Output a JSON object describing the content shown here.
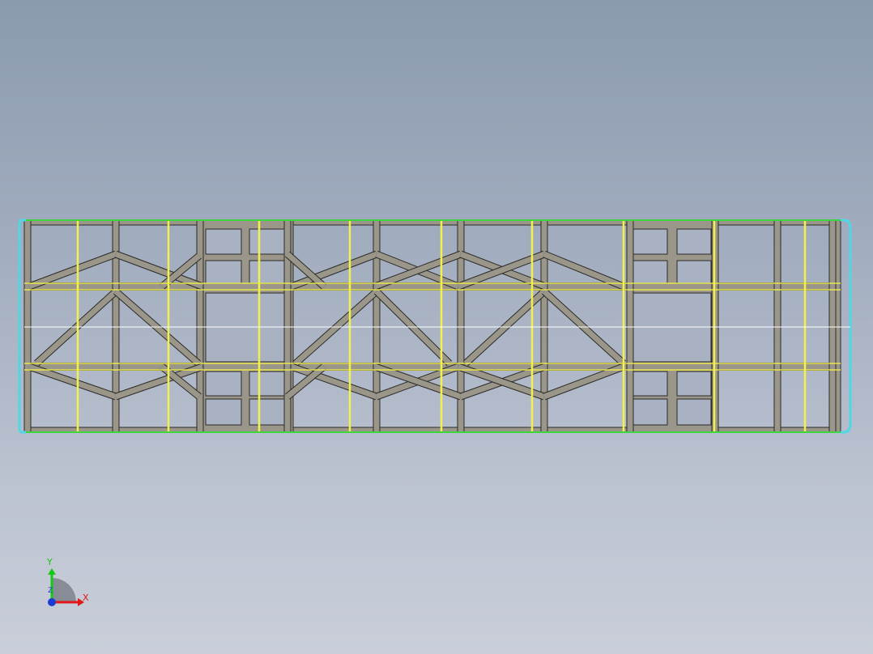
{
  "colors": {
    "member_fill": "#9a968a",
    "member_stroke": "#2b2a26",
    "yellow_edge": "#f2f04a",
    "green_edge": "#3ed63e",
    "cyan_edge": "#4fd7e6",
    "centerline": "#ffffff",
    "axis_x": "#e01818",
    "axis_y": "#16c816",
    "axis_z": "#1a3bd6"
  },
  "triad": {
    "x_label": "X",
    "y_label": "Y",
    "z_label": "Z",
    "icon": "coordinate-triad-icon"
  }
}
